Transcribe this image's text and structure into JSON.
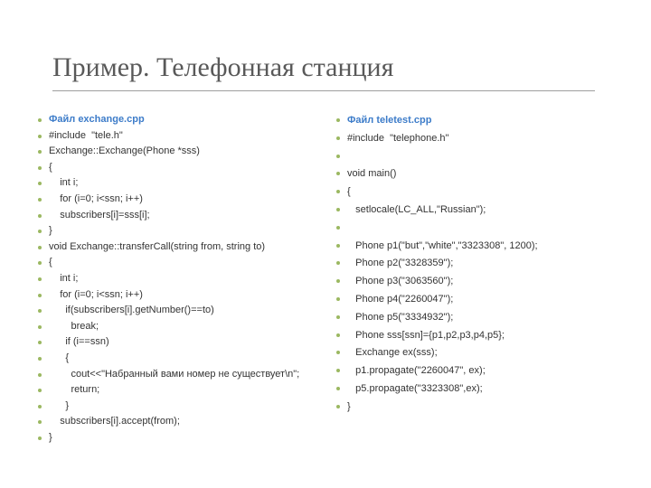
{
  "title": "Пример. Телефонная станция",
  "left": {
    "heading": "Файл exchange.cpp",
    "lines": [
      "#include  \"tele.h\"",
      "Exchange::Exchange(Phone *sss)",
      "{",
      "    int i;",
      "    for (i=0; i<ssn; i++)",
      "    subscribers[i]=sss[i];",
      "}",
      "void Exchange::transferCall(string from, string to)",
      "{",
      "    int i;",
      "    for (i=0; i<ssn; i++)",
      "      if(subscribers[i].getNumber()==to)",
      "        break;",
      "      if (i==ssn)",
      "      {",
      "        cout<<\"Набранный вами номер не существует\\n\";",
      "        return;",
      "      }",
      "    subscribers[i].accept(from);",
      "}"
    ]
  },
  "right": {
    "heading": "Файл teletest.cpp",
    "lines": [
      "#include  \"telephone.h\"",
      "",
      "void main()",
      "{",
      "   setlocale(LC_ALL,\"Russian\");",
      "",
      "   Phone p1(\"but\",\"white\",\"3323308\", 1200);",
      "   Phone p2(\"3328359\");",
      "   Phone p3(\"3063560\");",
      "   Phone p4(\"2260047\");",
      "   Phone p5(\"3334932\");",
      "   Phone sss[ssn]={p1,p2,p3,p4,p5};",
      "   Exchange ex(sss);",
      "   p1.propagate(\"2260047\", ex);",
      "   p5.propagate(\"3323308\",ex);",
      "}"
    ]
  }
}
